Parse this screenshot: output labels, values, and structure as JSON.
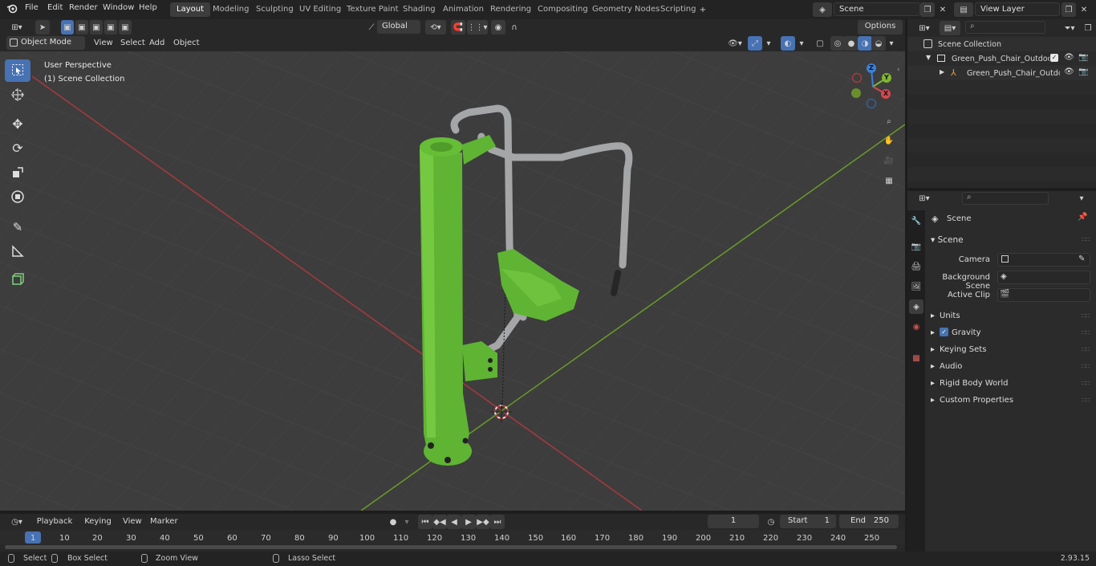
{
  "menu": {
    "file": "File",
    "edit": "Edit",
    "render": "Render",
    "window": "Window",
    "help": "Help"
  },
  "workspaces": [
    "Layout",
    "Modeling",
    "Sculpting",
    "UV Editing",
    "Texture Paint",
    "Shading",
    "Animation",
    "Rendering",
    "Compositing",
    "Geometry Nodes",
    "Scripting"
  ],
  "active_workspace": "Layout",
  "scene_field": "Scene",
  "view_layer_field": "View Layer",
  "viewport_header": {
    "transform_orientation": "Global",
    "options": "Options"
  },
  "viewport_menu": {
    "mode": "Object Mode",
    "view": "View",
    "select": "Select",
    "add": "Add",
    "object": "Object"
  },
  "viewport": {
    "perspective": "User Perspective",
    "collection": "(1) Scene Collection",
    "gizmo": {
      "x": "X",
      "y": "Y",
      "z": "Z"
    }
  },
  "outliner": {
    "root": "Scene Collection",
    "collection": "Green_Push_Chair_Outdoor_F",
    "object": "Green_Push_Chair_Outdc"
  },
  "properties": {
    "header": "Scene",
    "panel": "Scene",
    "camera_label": "Camera",
    "background_scene_label": "Background Scene",
    "active_clip_label": "Active Clip",
    "sections": [
      "Units",
      "Gravity",
      "Keying Sets",
      "Audio",
      "Rigid Body World",
      "Custom Properties"
    ]
  },
  "timeline": {
    "playback": "Playback",
    "keying": "Keying",
    "view": "View",
    "marker": "Marker",
    "current_frame": "1",
    "start_label": "Start",
    "start": "1",
    "end_label": "End",
    "end": "250",
    "ticks": [
      "1",
      "10",
      "20",
      "30",
      "40",
      "50",
      "60",
      "70",
      "80",
      "90",
      "100",
      "110",
      "120",
      "130",
      "140",
      "150",
      "160",
      "170",
      "180",
      "190",
      "200",
      "210",
      "220",
      "230",
      "240",
      "250"
    ]
  },
  "status": {
    "select": "Select",
    "box_select": "Box Select",
    "zoom_view": "Zoom View",
    "lasso_select": "Lasso Select",
    "version": "2.93.15"
  },
  "colors": {
    "accent": "#4772b3",
    "model_green": "#6abf3a",
    "model_gray": "#a9abad",
    "x_axis": "#b33a3a",
    "y_axis": "#6b9a2a"
  }
}
